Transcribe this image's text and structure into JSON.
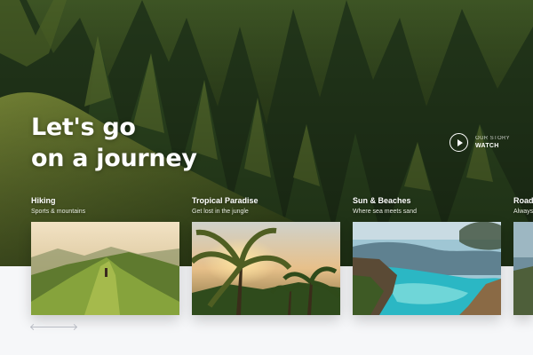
{
  "hero": {
    "headline_line1": "Let's go",
    "headline_line2": "on a journey",
    "story_small": "OUR STORY",
    "story_action": "WATCH"
  },
  "cards": [
    {
      "title": "Hiking",
      "subtitle": "Sports & mountains",
      "image": "mountain-ridge-hiker"
    },
    {
      "title": "Tropical Paradise",
      "subtitle": "Get lost in the jungle",
      "image": "palm-trees-sunset"
    },
    {
      "title": "Sun & Beaches",
      "subtitle": "Where sea meets sand",
      "image": "turquoise-cove"
    },
    {
      "title": "Road",
      "subtitle": "Always",
      "image": "road-partial"
    }
  ],
  "carousel": {
    "prev_icon": "arrow-left-icon",
    "next_icon": "arrow-right-icon"
  },
  "colors": {
    "background": "#f6f7f9",
    "text_on_image": "#ffffff",
    "nav_arrow": "#b9bcc4"
  }
}
